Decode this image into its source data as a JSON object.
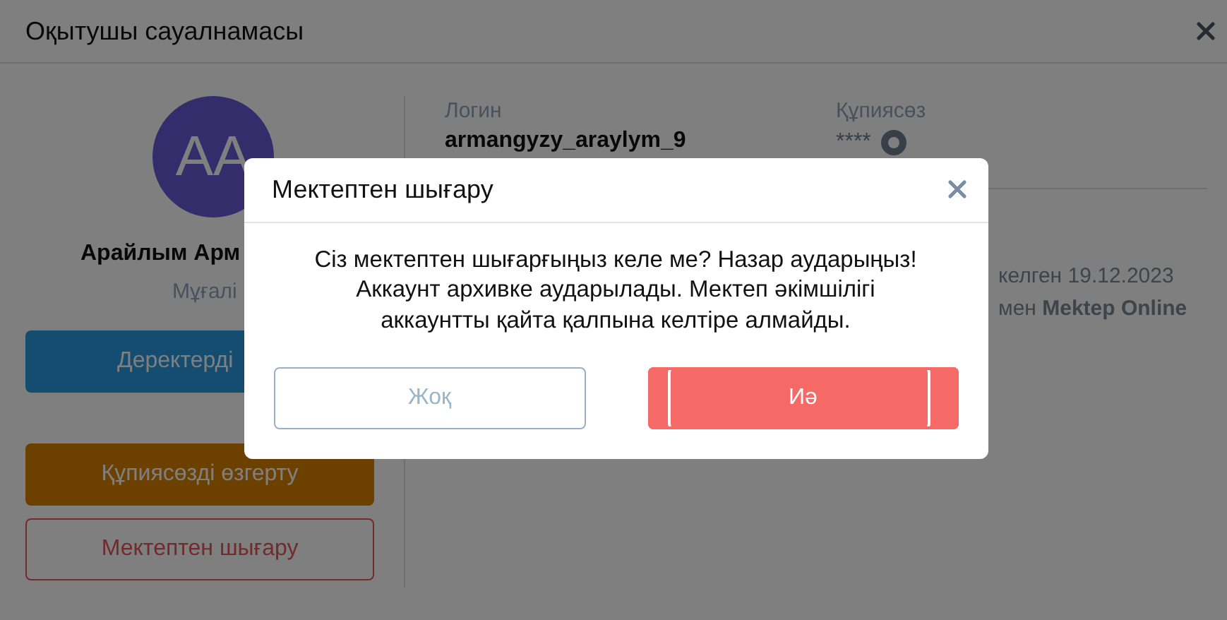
{
  "window": {
    "title": "Оқытушы сауалнамасы"
  },
  "profile": {
    "avatar_initials": "AA",
    "name": "Арайлым Арм",
    "role": "Мұғалі"
  },
  "actions": [
    {
      "label": "Деректерді",
      "kind": "primary"
    },
    {
      "label": "Құпиясөзді өзгерту",
      "kind": "warning"
    },
    {
      "label": "Мектептен шығару",
      "kind": "danger"
    }
  ],
  "fields": [
    {
      "label": "Логин",
      "value": "armangyzy_araylym_9",
      "kind": "text"
    },
    {
      "label": "Құпиясөз",
      "value": "****",
      "kind": "password"
    }
  ],
  "info": [
    "келген 19.12.2023",
    "мен **Mektep Online**"
  ],
  "dialog": {
    "title": "Мектептен шығару",
    "message": "Сіз мектептен шығарғыңыз келе ме? Назар аударыңыз! Аккаунт архивке аударылады. Мектеп әкімшілігі аккаунтты қайта қалпына келтіре алмайды.",
    "buttons": [
      {
        "label": "Жоқ",
        "kind": "cancel",
        "focused": false
      },
      {
        "label": "Иә",
        "kind": "confirm",
        "focused": true
      }
    ]
  }
}
